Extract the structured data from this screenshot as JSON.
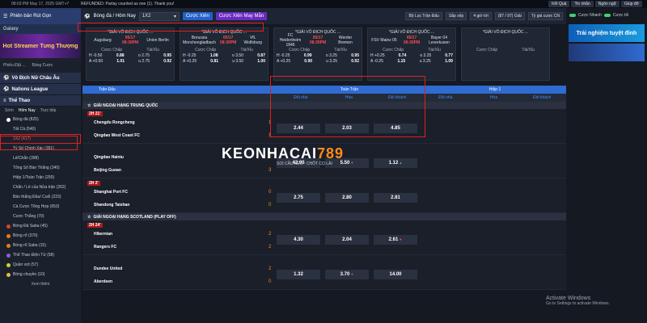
{
  "topbar": {
    "time": "08:03 PM May 17, 2025 GMT+7",
    "notice": "REFUNDED: Parlay counted as one (1). Thank you!",
    "buttons": [
      "Kết Quả",
      "Tin nhắn",
      "Ngôn ngữ",
      "Giúp đỡ"
    ]
  },
  "sidebar": {
    "head": "Phiên bản Rút Gọn",
    "galaxy": "Galaxy",
    "promo": "Hot Streamer Tưng Thượng",
    "ctrls": [
      "Phiếu Đặt ...",
      "Bảng Cược"
    ],
    "sections": [
      "Vô Địch Nữ Châu Âu",
      "Nations League",
      "Thể Thao"
    ],
    "tabs": [
      "Sớm",
      "Hôm Nay",
      "Trực tiếp"
    ],
    "items": [
      {
        "label": "Bóng đá (825)",
        "sub": false,
        "active": false,
        "color": "#ffffff"
      },
      {
        "label": "Tất Cả (540)",
        "sub": true,
        "active": false,
        "color": ""
      },
      {
        "label": "1X2 (417)",
        "sub": true,
        "active": true,
        "color": ""
      },
      {
        "label": "Tỷ Số Chính Xác (351)",
        "sub": true,
        "active": false,
        "color": ""
      },
      {
        "label": "Lẻ/Chẵn (398)",
        "sub": true,
        "active": false,
        "color": ""
      },
      {
        "label": "Tổng Số Bàn Thắng (340)",
        "sub": true,
        "active": false,
        "color": ""
      },
      {
        "label": "Hiệp 1/Toàn Trận (290)",
        "sub": true,
        "active": false,
        "color": ""
      },
      {
        "label": "Chẵn / Lẻ của Nửa trận (262)",
        "sub": true,
        "active": false,
        "color": ""
      },
      {
        "label": "Bàn thắng Đầu/ Cuối (223)",
        "sub": true,
        "active": false,
        "color": ""
      },
      {
        "label": "Cá Cược Tổng Hợp (653)",
        "sub": true,
        "active": false,
        "color": ""
      },
      {
        "label": "Cược Thắng (79)",
        "sub": true,
        "active": false,
        "color": ""
      },
      {
        "label": "Bóng Đá Saba (45)",
        "sub": false,
        "active": false,
        "color": "#d8432e"
      },
      {
        "label": "Bóng rổ (370)",
        "sub": false,
        "active": false,
        "color": "#e87a1e"
      },
      {
        "label": "Bóng rổ Saba (15)",
        "sub": false,
        "active": false,
        "color": "#e87a1e"
      },
      {
        "label": "Thể Thao Điện Tử (58)",
        "sub": false,
        "active": false,
        "color": "#8a5be0"
      },
      {
        "label": "Quần vợt (57)",
        "sub": false,
        "active": false,
        "color": "#c6d43a"
      },
      {
        "label": "Bóng chuyền (10)",
        "sub": false,
        "active": false,
        "color": "#e0c23a"
      }
    ],
    "more": "Xem thêm"
  },
  "filter": {
    "sport": "Bóng đá / Hôm Nay",
    "market": "1X2",
    "bet_btn": "Cược Xiên",
    "mix_btn": "Cược Xiên May Mắn",
    "league_filter": "Bộ Lọc Trận Đấu",
    "sort": "Sắp xếp",
    "time": "4 giờ tới",
    "count": "(87 / 97) Giải",
    "tz": "Tỷ giá cược CN"
  },
  "cards": [
    {
      "league": "*GIẢI VÔ ĐỊCH QUỐC ...",
      "live": "",
      "t1": "Augsburg",
      "t2": "Union Berlin",
      "time": "05/17 08:30PM",
      "rows": [
        [
          "H -0.50",
          "0.88",
          "o 2.75",
          "0.95"
        ],
        [
          "A +0.50",
          "1.01",
          "u 2.75",
          "0.92"
        ]
      ]
    },
    {
      "league": "*GIẢI VÔ ĐỊCH QUỐC ...",
      "live": "",
      "t1": "Borussia Monchengladbach",
      "t2": "VfL Wolfsburg",
      "time": "05/17 08:30PM",
      "rows": [
        [
          "H -0.25",
          "1.08",
          "o 3.50",
          "0.87"
        ],
        [
          "A +0.25",
          "0.81",
          "u 3.50",
          "1.00"
        ]
      ]
    },
    {
      "league": "*GIẢI VÔ ĐỊCH QUỐC ...",
      "live": "",
      "t1": "FC Heidenheim 1846",
      "t2": "Werder Bremen",
      "time": "05/17 08:30PM",
      "rows": [
        [
          "H -0.25",
          "0.99",
          "o 3.25",
          "0.95"
        ],
        [
          "A +0.25",
          "0.90",
          "u 3.25",
          "0.92"
        ]
      ]
    },
    {
      "league": "*GIẢI VÔ ĐỊCH QUỐC ...",
      "live": "",
      "t1": "FSV Mainz 05",
      "t2": "Bayer 04 Leverkusen",
      "time": "05/17 08:30PM",
      "rows": [
        [
          "H +0.25",
          "0.74",
          "o 3.25",
          "0.77"
        ],
        [
          "A -0.25",
          "1.15",
          "u 3.25",
          "1.09"
        ]
      ]
    },
    {
      "league": "*GIẢI VÔ ĐỊCH QUỐC ...",
      "live": "",
      "t1": "",
      "t2": "",
      "time": "",
      "rows": [
        [
          "",
          "",
          "",
          ""
        ],
        [
          "",
          "",
          "",
          ""
        ]
      ]
    }
  ],
  "table": {
    "title": "Trận Đấu",
    "full": "Toàn Trận",
    "half": "Hiệp 1",
    "show": "Lựa chọn bình thường",
    "cols": [
      "Đội nhà",
      "Hòa",
      "Đội khách",
      "Đội nhà",
      "Hòa",
      "Đội khách"
    ],
    "leagues": [
      {
        "name": "GIẢI NGOẠI HẠNG TRUNG QUỐC",
        "matches": [
          {
            "time": "2H 21'",
            "t1": "Chengdu Rongcheng",
            "t2": "Qingdao West Coast FC",
            "s1": "1",
            "s2": "1",
            "odds": [
              "2.44",
              "2.03",
              "4.85"
            ],
            "arrows": [
              "",
              "",
              ""
            ]
          },
          {
            "time": "",
            "t1": "Qingdao Hainiu",
            "t2": "Beijing Guoan",
            "s1": "0",
            "s2": "3",
            "odds": [
              "42.00",
              "5.50",
              "1.12"
            ],
            "arrows": [
              "",
              "down",
              "up"
            ]
          },
          {
            "time": "2H 2'",
            "t1": "Shanghai Port FC",
            "t2": "Shandong Taishan",
            "s1": "0",
            "s2": "0",
            "odds": [
              "2.75",
              "2.80",
              "2.81"
            ],
            "arrows": [
              "",
              "",
              ""
            ]
          }
        ]
      },
      {
        "name": "GIẢI NGOẠI HẠNG SCOTLAND (PLAY OFF)",
        "matches": [
          {
            "time": "2H 24'",
            "t1": "Hibernian",
            "t2": "Rangers FC",
            "s1": "2",
            "s2": "2",
            "odds": [
              "4.30",
              "2.04",
              "2.61"
            ],
            "arrows": [
              "",
              "",
              "down"
            ]
          },
          {
            "time": "",
            "t1": "Dundee United",
            "t2": "Aberdeen",
            "s1": "2",
            "s2": "0",
            "odds": [
              "1.32",
              "3.70",
              "14.00"
            ],
            "arrows": [
              "",
              "down",
              ""
            ]
          }
        ]
      }
    ]
  },
  "watermark": {
    "main": "KEONHACAI",
    "num": "789",
    "sub": "SOI CẦU KÈO - CHỐT CỌ LÀI"
  },
  "right": {
    "toggle1": "Cược Nhanh",
    "toggle2": "Cược tối",
    "banner1": "Trải nghiệm tuyệt đỉnh",
    "banner2": ""
  },
  "win": {
    "title": "Activate Windows",
    "sub": "Go to Settings to activate Windows."
  },
  "colors": {
    "accent": "#2f6bd0",
    "live": "#b01818",
    "score": "#ff8c1a",
    "highlight": "#e02020"
  }
}
